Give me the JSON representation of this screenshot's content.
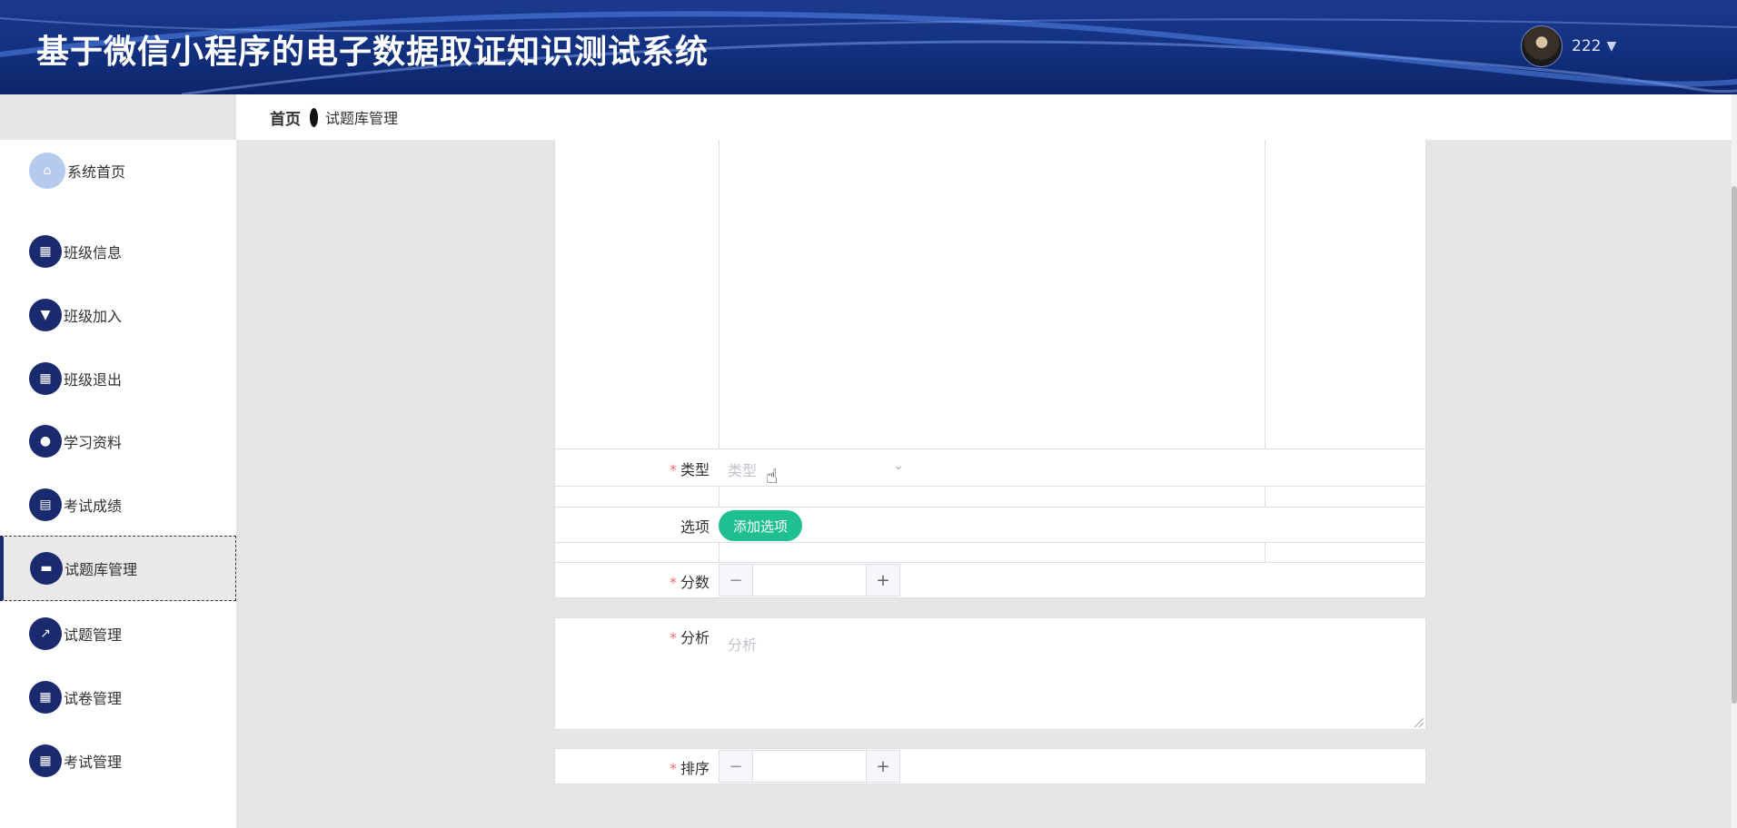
{
  "header": {
    "title": "基于微信小程序的电子数据取证知识测试系统",
    "username": "222",
    "caret": "▼"
  },
  "breadcrumb": {
    "home": "首页",
    "current": "试题库管理"
  },
  "sidebar": {
    "items": [
      {
        "label": "系统首页",
        "icon": "home-icon",
        "glyph": "⌂"
      },
      {
        "label": "班级信息",
        "icon": "grid-icon",
        "glyph": "▦"
      },
      {
        "label": "班级加入",
        "icon": "pin-icon",
        "glyph": "▼"
      },
      {
        "label": "班级退出",
        "icon": "grid-icon",
        "glyph": "▦"
      },
      {
        "label": "学习资料",
        "icon": "user-icon",
        "glyph": "●"
      },
      {
        "label": "考试成绩",
        "icon": "table-icon",
        "glyph": "▤"
      },
      {
        "label": "试题库管理",
        "icon": "briefcase-icon",
        "glyph": "▬"
      },
      {
        "label": "试题管理",
        "icon": "chart-icon",
        "glyph": "↗"
      },
      {
        "label": "试卷管理",
        "icon": "grid-icon",
        "glyph": "▦"
      },
      {
        "label": "考试管理",
        "icon": "grid-icon",
        "glyph": "▦"
      }
    ],
    "active_index": 6
  },
  "form": {
    "type_label": "类型",
    "type_placeholder": "类型",
    "options_label": "选项",
    "add_option_button": "添加选项",
    "score_label": "分数",
    "analysis_label": "分析",
    "analysis_placeholder": "分析",
    "sort_label": "排序",
    "required_mark": "*",
    "minus": "−",
    "plus": "+"
  },
  "colors": {
    "header_bg": "#12307f",
    "nav_icon": "#1a2a6e",
    "accent_green": "#1fbf91",
    "required": "#f56c6c"
  }
}
